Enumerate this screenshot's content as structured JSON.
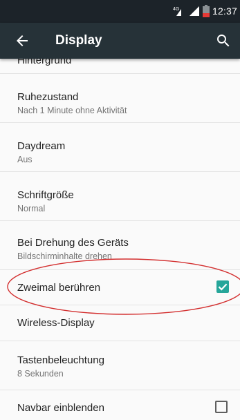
{
  "status_bar": {
    "network": "4G",
    "time": "12:37"
  },
  "app_bar": {
    "title": "Display",
    "back_icon": "arrow-back-icon",
    "search_icon": "search-icon"
  },
  "settings": [
    {
      "title": "Hintergrund"
    },
    {
      "title": "Ruhezustand",
      "subtitle": "Nach 1 Minute ohne Aktivität"
    },
    {
      "title": "Daydream",
      "subtitle": "Aus"
    },
    {
      "title": "Schriftgröße",
      "subtitle": "Normal"
    },
    {
      "title": "Bei Drehung des Geräts",
      "subtitle": "Bildschirminhalte drehen"
    },
    {
      "title": "Zweimal berühren",
      "checked": true
    },
    {
      "title": "Wireless-Display"
    },
    {
      "title": "Tastenbeleuchtung",
      "subtitle": "8 Sekunden"
    },
    {
      "title": "Navbar einblenden",
      "checked": false
    }
  ],
  "colors": {
    "accent": "#26a69a",
    "appbar": "#263238",
    "statusbar": "#1c2329",
    "annotation": "#d32f2f"
  }
}
